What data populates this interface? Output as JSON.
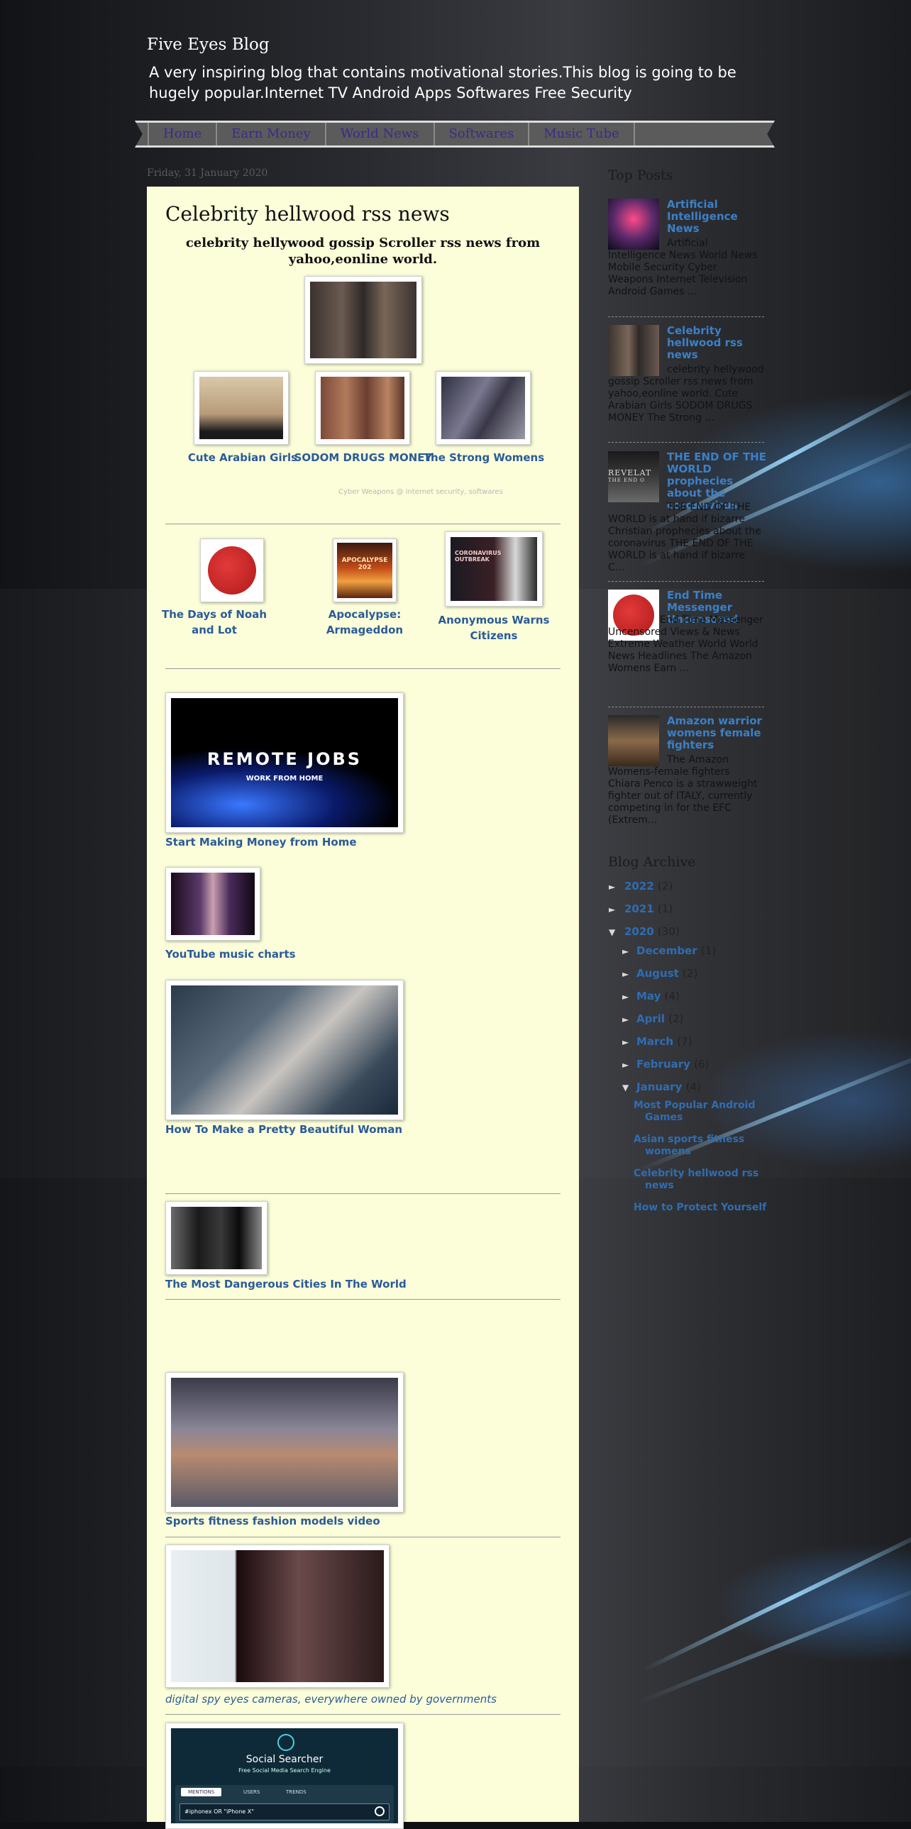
{
  "blog": {
    "title": "Five Eyes Blog",
    "description": "A very inspiring blog that contains motivational stories.This blog is going to be hugely popular.Internet TV Android Apps Softwares Free Security"
  },
  "nav": [
    "Home",
    "Earn Money",
    "World News",
    "Softwares",
    "Music Tube"
  ],
  "post": {
    "date": "Friday, 31 January 2020",
    "title": "Celebrity hellwood rss news",
    "subtitle": "celebrity hellywood gossip Scroller rss news from yahoo,eonline world.",
    "row1_captions": [
      "Cute Arabian Girls",
      "SODOM DRUGS MONEY",
      "The Strong Womens"
    ],
    "small_text": "Cyber Weapons @ internet security, softwares",
    "row2_captions": [
      "The Days of Noah and Lot",
      "Apocalypse: Armageddon",
      "Anonymous Warns Citizens"
    ],
    "remote_jobs_title": "REMOTE JOBS",
    "remote_jobs_sub": "WORK FROM HOME",
    "apocalypse_thumb": "APOCALYPSE 202",
    "outbreak_thumb": "CORONAVIRUS OUTBREAK",
    "links": [
      "Start Making Money from Home",
      "YouTube music charts",
      "How To Make a Pretty Beautiful Woman",
      "The Most Dangerous Cities In The World",
      "Sports fitness fashion models video",
      "digital spy eyes cameras, everywhere owned by governments"
    ],
    "social_searcher": {
      "title": "Social Searcher",
      "sub": "Free Social Media Search Engine",
      "tabs": [
        "MENTIONS",
        "USERS",
        "TRENDS"
      ],
      "query": "#iphonex OR \"iPhone X\""
    }
  },
  "sidebar": {
    "top_posts_heading": "Top Posts",
    "top_posts": [
      {
        "title": "Artificial Intelligence News",
        "snippet": "Artificial Intelligence News   World News Mobile Security Cyber Weapons Internet Television Android Games ..."
      },
      {
        "title": "Celebrity hellwood rss news",
        "snippet": "celebrity hellywood gossip Scroller rss news from yahoo,eonline world. Cute Arabian Girls SODOM DRUGS MONEY The Strong ..."
      },
      {
        "title": "THE END OF THE WORLD prophecies about the coronavirus",
        "snippet": "THE END OF THE WORLD is at hand if bizarre Christian prophecies about the coronavirus THE END OF THE WORLD is at hand if bizarre C..."
      },
      {
        "title": "End Time Messenger Uncensored",
        "snippet": "End Time Messenger Uncensored Views & News Extreme Weather World World News Headlines The Amazon Womens Earn ..."
      },
      {
        "title": "Amazon warrior womens female fighters",
        "snippet": "The Amazon Womens-female fighters  Chiara Penco is a strawweight fighter out of ITALY, currently competing in for the EFC (Extrem..."
      }
    ],
    "revelation_thumb": "REVELAT",
    "revelation_sub": "THE END O",
    "archive_heading": "Blog Archive",
    "years": [
      {
        "year": "2022",
        "count": "(2)"
      },
      {
        "year": "2021",
        "count": "(1)"
      },
      {
        "year": "2020",
        "count": "(30)"
      }
    ],
    "months": [
      {
        "month": "December",
        "count": "(1)"
      },
      {
        "month": "August",
        "count": "(2)"
      },
      {
        "month": "May",
        "count": "(4)"
      },
      {
        "month": "April",
        "count": "(2)"
      },
      {
        "month": "March",
        "count": "(7)"
      },
      {
        "month": "February",
        "count": "(6)"
      },
      {
        "month": "January",
        "count": "(4)"
      }
    ],
    "january_posts": [
      "Most Popular Android Games",
      "Asian sports fitness womens",
      "Celebrity hellwood rss news",
      "How to Protect Yourself"
    ]
  },
  "colors": {
    "post_bg": "#fbfed9",
    "link": "#2a5b99",
    "sidebar_link": "#2e6db3",
    "nav_text": "#3a2a8a"
  }
}
